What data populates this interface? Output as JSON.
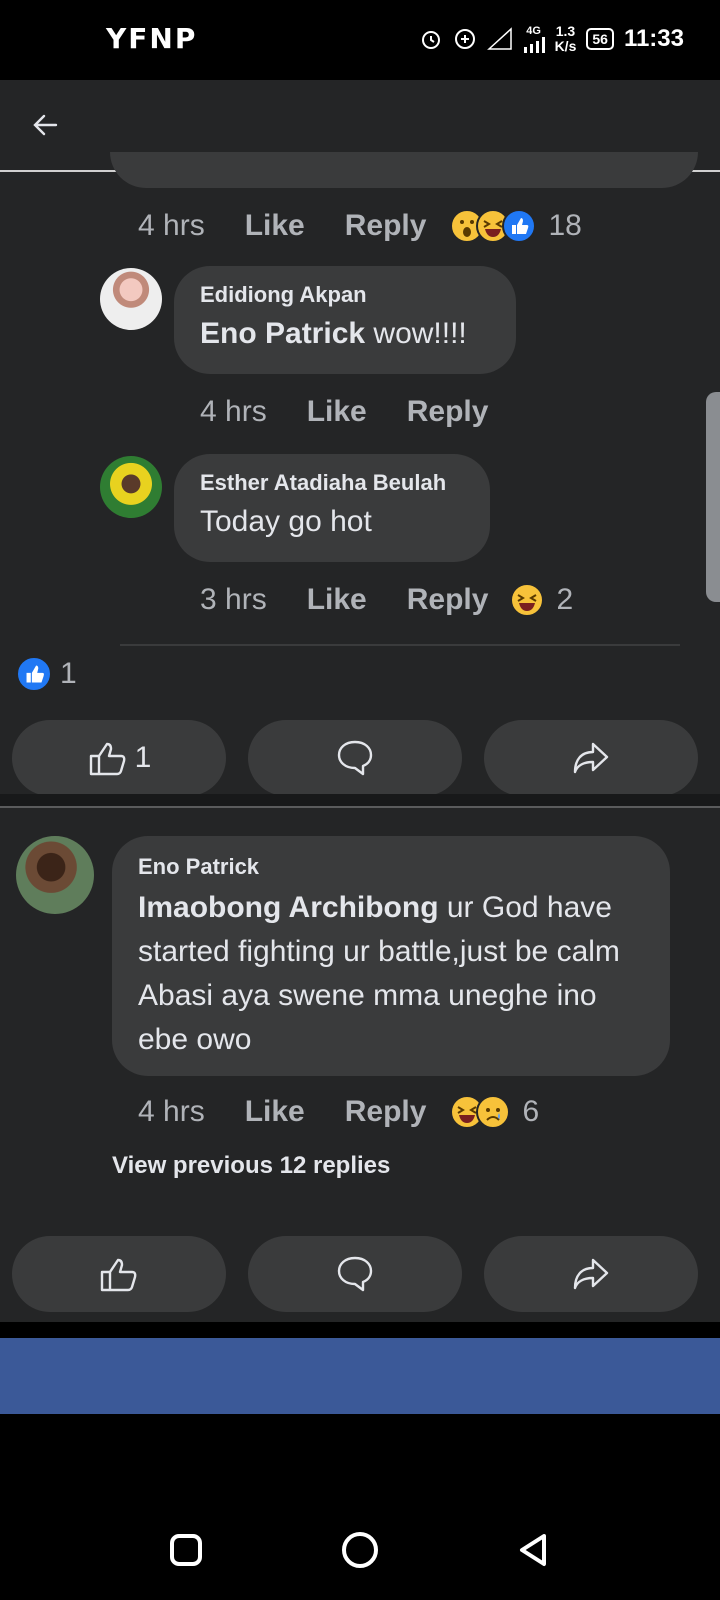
{
  "status_bar": {
    "apps": "YFNP",
    "network": "4G",
    "speed_value": "1.3",
    "speed_unit": "K/s",
    "battery": "56",
    "time": "11:33"
  },
  "thread": {
    "prev_meta": {
      "time": "4 hrs",
      "like": "Like",
      "reply": "Reply",
      "reactions": [
        "wow",
        "haha",
        "like"
      ],
      "count": "18"
    },
    "replies": [
      {
        "author": "Edidiong Akpan",
        "mention": "Eno Patrick",
        "text": " wow!!!!",
        "time": "4 hrs",
        "like": "Like",
        "reply": "Reply"
      },
      {
        "author": "Esther Atadiaha Beulah",
        "mention": "",
        "text": "Today go hot",
        "time": "3 hrs",
        "like": "Like",
        "reply": "Reply",
        "reactions": [
          "haha"
        ],
        "count": "2"
      }
    ],
    "post_reaction_count": "1",
    "post_like_count": "1"
  },
  "comment": {
    "author": "Eno Patrick",
    "mention": "Imaobong Archibong",
    "text": " ur God have started fighting ur battle,just be calm Abasi aya swene mma uneghe ino ebe owo",
    "time": "4 hrs",
    "like": "Like",
    "reply": "Reply",
    "reactions": [
      "haha",
      "sad"
    ],
    "count": "6",
    "view_previous": "View previous 12 replies"
  },
  "icons": [
    "back-arrow-icon",
    "like-icon",
    "comment-icon",
    "share-icon",
    "recents-icon",
    "home-icon",
    "back-triangle-icon"
  ],
  "colors": {
    "background": "#242526",
    "bubble": "#3a3b3c",
    "accent_blue": "#2078f4",
    "banner": "#3b5998"
  }
}
